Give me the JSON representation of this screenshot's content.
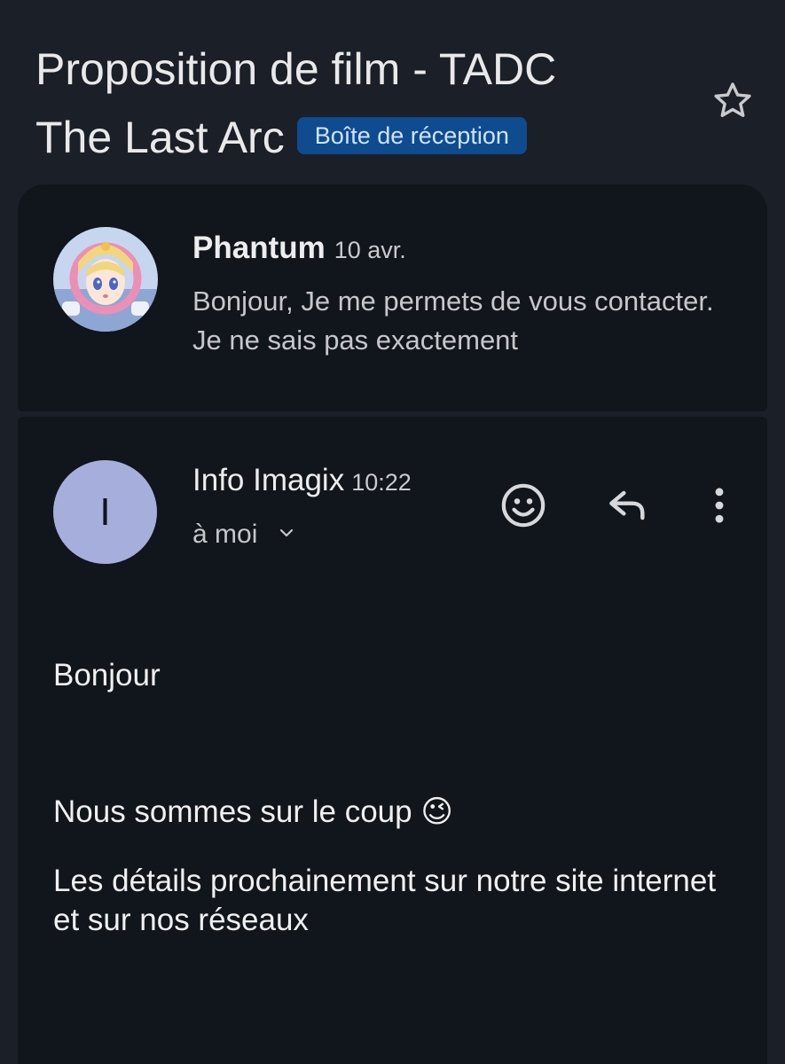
{
  "thread": {
    "subject_line1": "Proposition de film - TADC",
    "subject_line2": "The Last Arc",
    "label": "Boîte de réception",
    "star_icon": "star-outline-icon"
  },
  "messages": [
    {
      "sender": "Phantum",
      "date": "10 avr.",
      "snippet": "Bonjour, Je me permets de vous contacter. Je ne sais pas exactement"
    },
    {
      "sender": "Info Imagix",
      "time": "10:22",
      "avatar_letter": "I",
      "recipient": "à moi",
      "body": {
        "p1": "Bonjour",
        "p2": "Nous sommes sur le coup 😉",
        "p3": "Les détails prochainement sur notre site internet et sur nos réseaux"
      }
    }
  ],
  "colors": {
    "background": "#1b1f27",
    "card": "#11151c",
    "label_chip": "#0e4b8f",
    "avatar_letter_bg": "#a6aedc"
  }
}
